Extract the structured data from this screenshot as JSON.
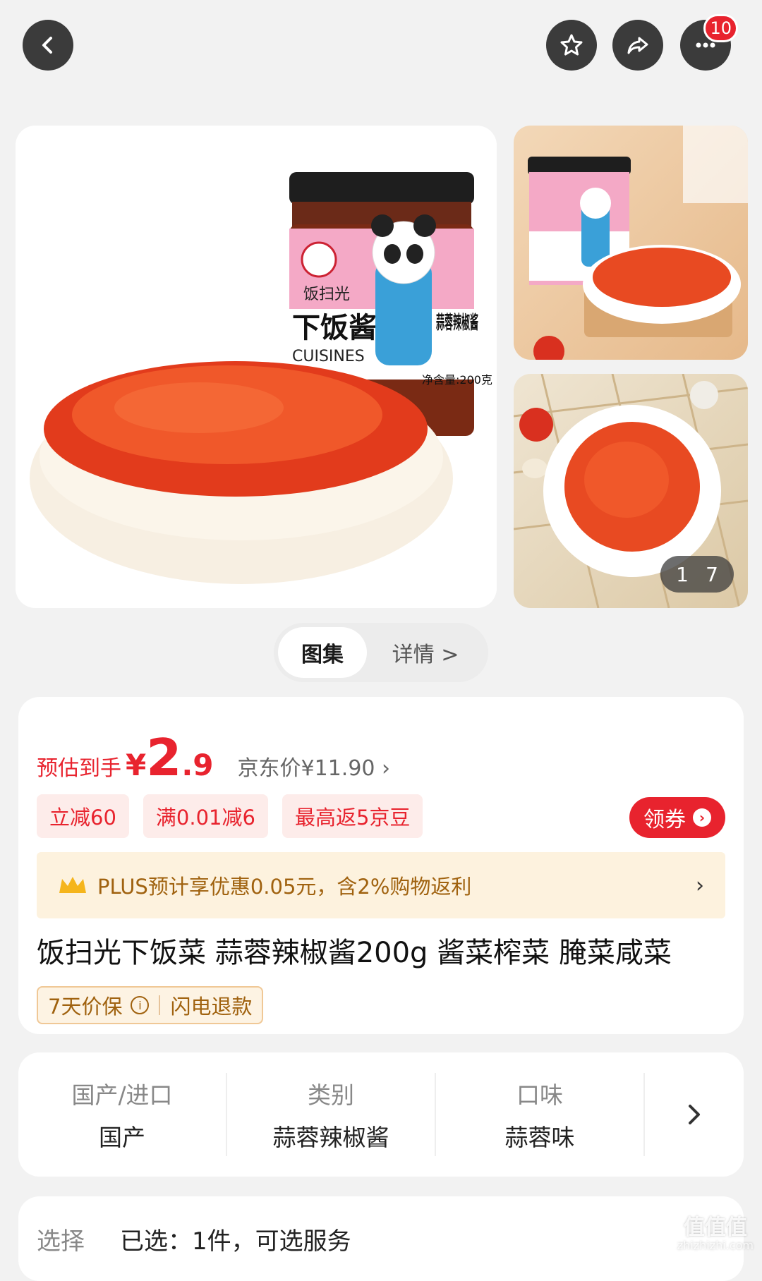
{
  "topbar": {
    "notification_count": "10"
  },
  "gallery": {
    "jar_brand": "饭扫光",
    "jar_product": "下饭酱",
    "jar_sub": "CUISINES",
    "jar_flavor": "蒜蓉辣椒酱",
    "jar_net": "净含量:200克",
    "counter_current": "1",
    "counter_total": "7"
  },
  "segment": {
    "active": "图集",
    "inactive": "详情 >"
  },
  "price": {
    "est_label": "预估到手",
    "currency": "¥",
    "int": "2",
    "dec": ".9",
    "jd_price": "京东价¥11.90 ›"
  },
  "coupons": [
    "立减60",
    "满0.01减6",
    "最高返5京豆"
  ],
  "claim_label": "领券",
  "plus": {
    "text": "PLUS预计享优惠0.05元，含2%购物返利",
    "arrow": "›"
  },
  "product_title": "饭扫光下饭菜 蒜蓉辣椒酱200g 酱菜榨菜 腌菜咸菜",
  "guarantee": {
    "price_protect": "7天价保",
    "refund": "闪电退款"
  },
  "attributes": [
    {
      "k": "国产/进口",
      "v": "国产"
    },
    {
      "k": "类别",
      "v": "蒜蓉辣椒酱"
    },
    {
      "k": "口味",
      "v": "蒜蓉味"
    }
  ],
  "select": {
    "label": "选择",
    "value": "已选：1件，可选服务"
  },
  "watermark": {
    "main": "值值值",
    "url": "zhizhizhi.com"
  },
  "colors": {
    "accent": "#e8232e",
    "plus_text": "#a0620f",
    "plus_bg": "#fdf2de"
  }
}
